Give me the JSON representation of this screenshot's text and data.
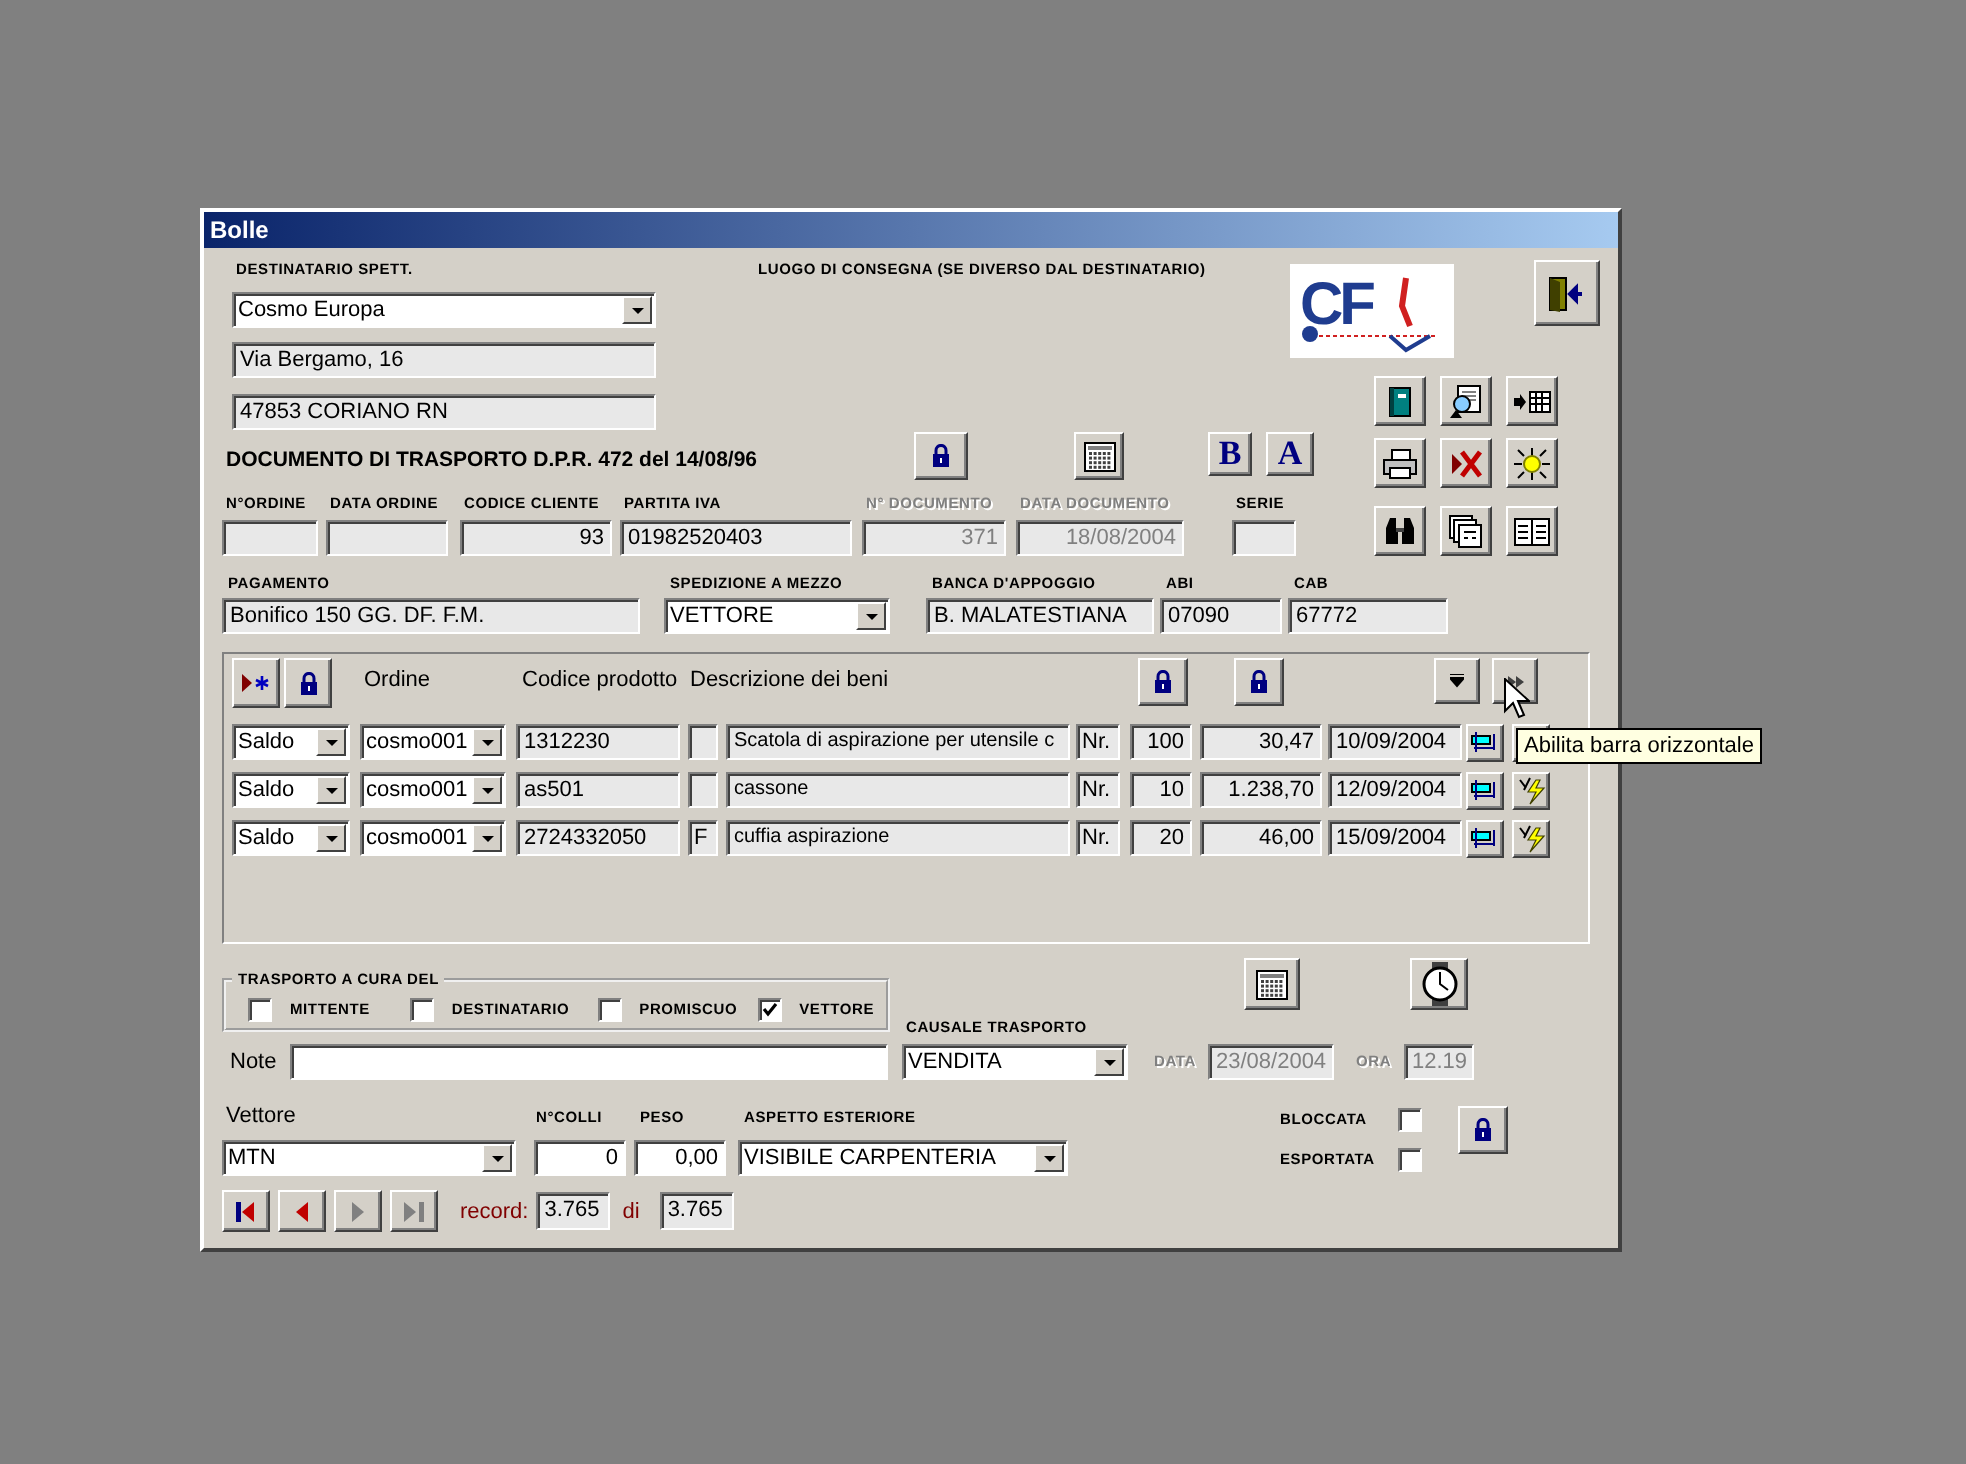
{
  "window": {
    "title": "Bolle"
  },
  "recipient": {
    "label": "DESTINATARIO SPETT.",
    "name": "Cosmo Europa",
    "address": "Via Bergamo, 16",
    "city": "47853 CORIANO RN"
  },
  "delivery_place": {
    "label": "LUOGO DI CONSEGNA (SE DIVERSO DAL DESTINATARIO)"
  },
  "logo": {
    "text": "CF"
  },
  "document_title": "DOCUMENTO DI TRASPORTO D.P.R. 472 del 14/08/96",
  "format_buttons": [
    "B",
    "A"
  ],
  "header_fields": [
    {
      "label": "N°ORDINE",
      "disabled": false
    },
    {
      "label": "DATA ORDINE",
      "disabled": false
    },
    {
      "label": "CODICE CLIENTE",
      "value": "93",
      "disabled": false
    },
    {
      "label": "PARTITA IVA",
      "value": "01982520403",
      "disabled": false
    },
    {
      "label": "N° DOCUMENTO",
      "value": "371",
      "disabled": true
    },
    {
      "label": "DATA DOCUMENTO",
      "value": "18/08/2004",
      "disabled": true
    },
    {
      "label": "SERIE",
      "disabled": false
    }
  ],
  "payment_fields": [
    {
      "label": "PAGAMENTO",
      "value": "Bonifico 150 GG. DF. F.M.",
      "kind": "text"
    },
    {
      "label": "SPEDIZIONE A MEZZO",
      "value": "VETTORE",
      "kind": "combo"
    },
    {
      "label": "BANCA D'APPOGGIO",
      "value": "B. MALATESTIANA",
      "kind": "text"
    },
    {
      "label": "ABI",
      "value": "07090",
      "kind": "text"
    },
    {
      "label": "CAB",
      "value": "67772",
      "kind": "text"
    }
  ],
  "lines": {
    "columns": [
      "Ordine",
      "Codice prodotto",
      "Descrizione dei beni"
    ],
    "rows": [
      {
        "type": "Saldo",
        "order": "cosmo001",
        "code": "1312230",
        "description": "Scatola di aspirazione per utensile c",
        "unit": "Nr.",
        "quantity": "100",
        "price": "30,47",
        "date": "10/09/2004"
      },
      {
        "type": "Saldo",
        "order": "cosmo001",
        "code": "as501",
        "description": "cassone",
        "unit": "Nr.",
        "quantity": "10",
        "price": "1.238,70",
        "date": "12/09/2004"
      },
      {
        "type": "Saldo",
        "order": "cosmo001",
        "code": "2724332050",
        "flag": "F",
        "description": "cuffia aspirazione",
        "unit": "Nr.",
        "quantity": "20",
        "price": "46,00",
        "date": "15/09/2004"
      }
    ],
    "tooltip": "Abilita barra orizzontale"
  },
  "transport_by": {
    "label": "TRASPORTO A CURA DEL",
    "options": [
      {
        "label": "MITTENTE",
        "checked": false
      },
      {
        "label": "DESTINATARIO",
        "checked": false
      },
      {
        "label": "PROMISCUO",
        "checked": false
      },
      {
        "label": "VETTORE",
        "checked": true
      }
    ]
  },
  "causale": {
    "label": "CAUSALE TRASPORTO",
    "value": "VENDITA"
  },
  "note": {
    "label": "Note"
  },
  "date": {
    "label": "DATA",
    "value": "23/08/2004"
  },
  "time": {
    "label": "ORA",
    "value": "12.19"
  },
  "shipping": {
    "carrier_label": "Vettore",
    "carrier": "MTN",
    "packages_label": "N°COLLI",
    "packages": "0",
    "weight_label": "PESO",
    "weight": "0,00",
    "appearance_label": "ASPETTO ESTERIORE",
    "appearance": "VISIBILE CARPENTERIA"
  },
  "flags": [
    {
      "label": "BLOCCATA",
      "checked": false
    },
    {
      "label": "ESPORTATA",
      "checked": false
    }
  ],
  "navigation": {
    "buttons": [
      {
        "kind": "first",
        "disabled": false
      },
      {
        "kind": "prev",
        "disabled": false
      },
      {
        "kind": "next",
        "disabled": true
      },
      {
        "kind": "last",
        "disabled": true
      }
    ],
    "record_label": "record:",
    "current": "3.765",
    "of_label": "di",
    "total": "3.765"
  }
}
